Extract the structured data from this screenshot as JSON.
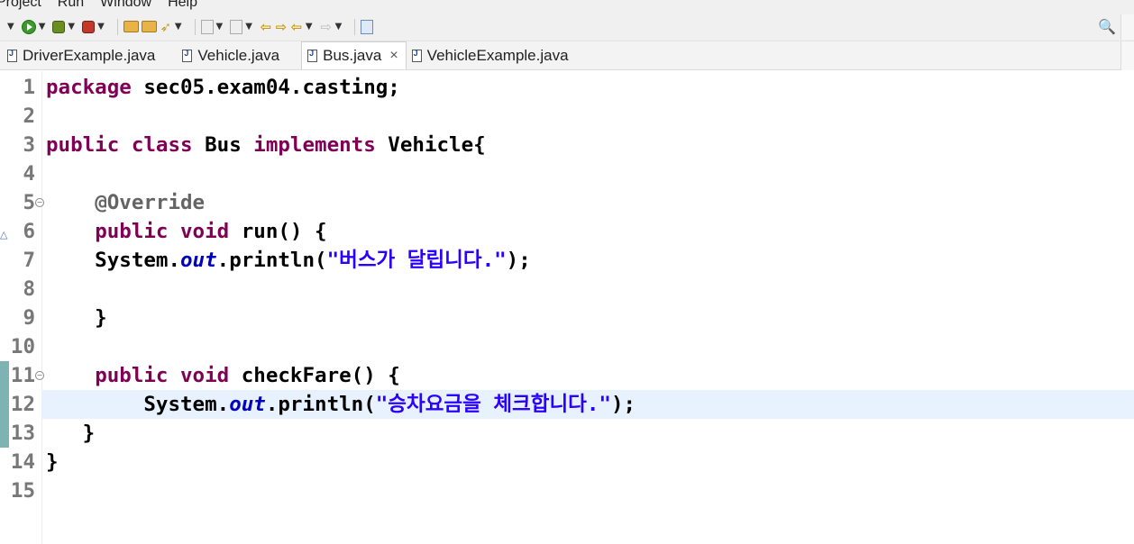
{
  "menu": [
    "Project",
    "Run",
    "Window",
    "Help"
  ],
  "toolbar": {
    "buttons": [
      "new-dropdown",
      "run-icon",
      "debug-icon",
      "coverage-icon",
      "open-folder-icon",
      "open-folder-icon",
      "build-icon",
      "annotation-icon",
      "navigate-icon",
      "prev-edit-icon",
      "next-edit-icon",
      "back-icon",
      "forward-icon",
      "open-perspective-icon"
    ],
    "search_icon": "search-icon"
  },
  "tabs": [
    {
      "label": "DriverExample.java",
      "active": false
    },
    {
      "label": "Vehicle.java",
      "active": false
    },
    {
      "label": "Bus.java",
      "active": true,
      "close": "×"
    },
    {
      "label": "VehicleExample.java",
      "active": false
    }
  ],
  "editor": {
    "current_line": 12,
    "lines": [
      {
        "n": "1",
        "tokens": [
          {
            "t": "package",
            "c": "kw"
          },
          {
            "t": " sec05.exam04.casting;",
            "c": "plain"
          }
        ]
      },
      {
        "n": "2",
        "tokens": []
      },
      {
        "n": "3",
        "tokens": [
          {
            "t": "public",
            "c": "kw"
          },
          {
            "t": " ",
            "c": "plain"
          },
          {
            "t": "class",
            "c": "kw"
          },
          {
            "t": " Bus ",
            "c": "plain"
          },
          {
            "t": "implements",
            "c": "kw"
          },
          {
            "t": " Vehicle{",
            "c": "plain"
          }
        ]
      },
      {
        "n": "4",
        "tokens": []
      },
      {
        "n": "5",
        "fold": "⊖",
        "tokens": [
          {
            "t": "    ",
            "c": "plain"
          },
          {
            "t": "@Override",
            "c": "ann"
          }
        ]
      },
      {
        "n": "6",
        "override": "△",
        "tokens": [
          {
            "t": "    ",
            "c": "plain"
          },
          {
            "t": "public",
            "c": "kw"
          },
          {
            "t": " ",
            "c": "plain"
          },
          {
            "t": "void",
            "c": "kw"
          },
          {
            "t": " run() {",
            "c": "plain"
          }
        ]
      },
      {
        "n": "7",
        "tokens": [
          {
            "t": "    System.",
            "c": "plain"
          },
          {
            "t": "out",
            "c": "fld"
          },
          {
            "t": ".println(",
            "c": "plain"
          },
          {
            "t": "\"버스가 달립니다.\"",
            "c": "str"
          },
          {
            "t": ");",
            "c": "plain"
          }
        ]
      },
      {
        "n": "8",
        "tokens": []
      },
      {
        "n": "9",
        "tokens": [
          {
            "t": "    }",
            "c": "plain"
          }
        ]
      },
      {
        "n": "10",
        "tokens": []
      },
      {
        "n": "11",
        "fold": "⊖",
        "changed": true,
        "tokens": [
          {
            "t": "    ",
            "c": "plain"
          },
          {
            "t": "public",
            "c": "kw"
          },
          {
            "t": " ",
            "c": "plain"
          },
          {
            "t": "void",
            "c": "kw"
          },
          {
            "t": " checkFare() {",
            "c": "plain"
          }
        ]
      },
      {
        "n": "12",
        "changed": true,
        "tokens": [
          {
            "t": "        System.",
            "c": "plain"
          },
          {
            "t": "out",
            "c": "fld"
          },
          {
            "t": ".println(",
            "c": "plain"
          },
          {
            "t": "\"승차요금을 체크합니다.\"",
            "c": "str"
          },
          {
            "t": ");",
            "c": "plain"
          }
        ]
      },
      {
        "n": "13",
        "changed": true,
        "tokens": [
          {
            "t": "   }",
            "c": "plain"
          }
        ]
      },
      {
        "n": "14",
        "tokens": [
          {
            "t": "}",
            "c": "plain"
          }
        ]
      },
      {
        "n": "15",
        "tokens": []
      }
    ]
  },
  "colors": {
    "keyword": "#7f0055",
    "annotation": "#646464",
    "string": "#2a00ff",
    "field": "#0000c0",
    "current_line": "#e8f2fe",
    "change_bar": "#7fb2b2"
  }
}
